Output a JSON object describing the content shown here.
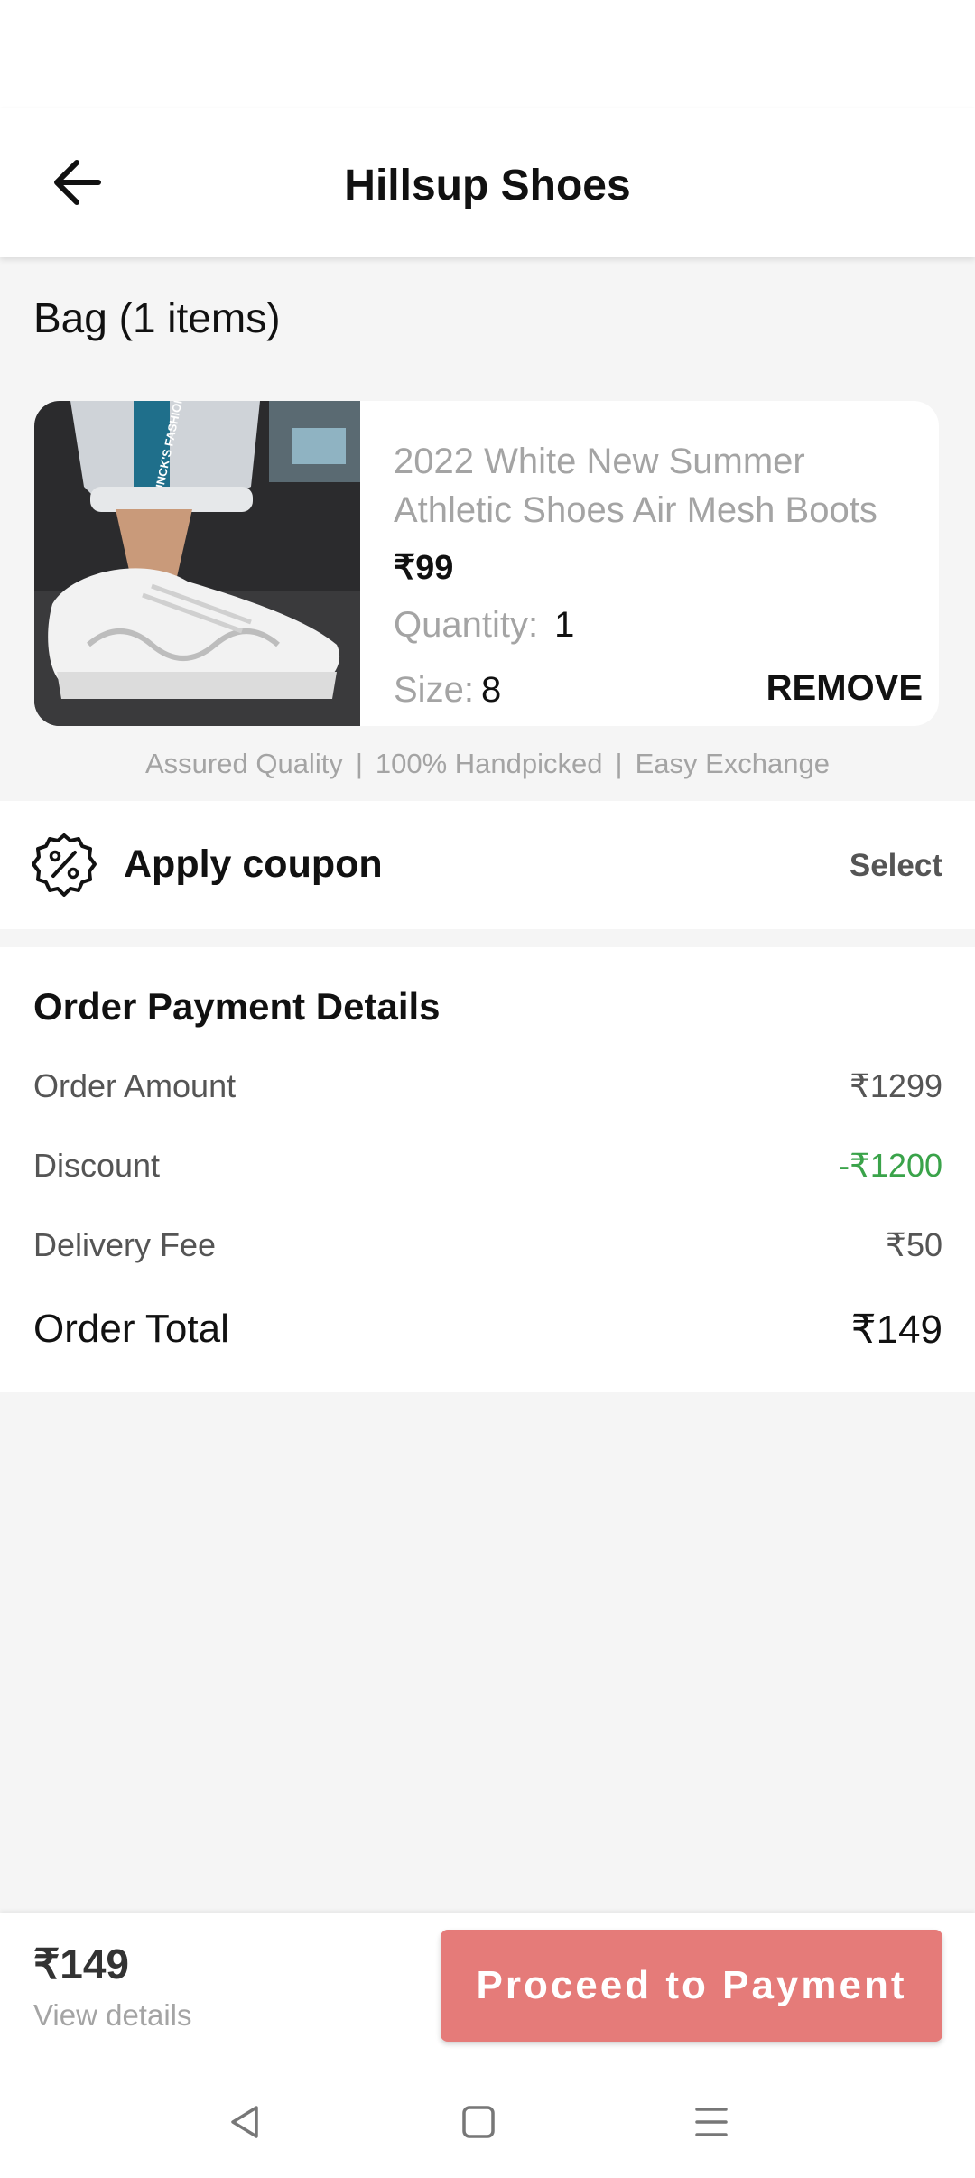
{
  "header": {
    "title": "Hillsup Shoes"
  },
  "bag": {
    "title": "Bag (1 items)",
    "item": {
      "name": "2022 White New Summer Athletic Shoes Air Mesh Boots",
      "price": "₹99",
      "quantity_label": "Quantity:",
      "quantity": "1",
      "size_label": "Size:",
      "size": "8",
      "remove_label": "REMOVE",
      "image_text": "RUNCK'S FASHION"
    }
  },
  "assurance": [
    "Assured Quality",
    "100% Handpicked",
    "Easy Exchange"
  ],
  "assurance_separator": "|",
  "coupon": {
    "label": "Apply coupon",
    "action": "Select"
  },
  "payment": {
    "title": "Order Payment Details",
    "rows": [
      {
        "label": "Order Amount",
        "value": "₹1299"
      },
      {
        "label": "Discount",
        "value": "-₹1200"
      },
      {
        "label": "Delivery Fee",
        "value": "₹50"
      }
    ],
    "total_label": "Order Total",
    "total_value": "₹149"
  },
  "footer": {
    "total": "₹149",
    "view_details": "View details",
    "proceed_label": "Proceed to Payment"
  },
  "colors": {
    "accent_button": "#e57b79",
    "discount_green": "#3aa34a",
    "muted_text": "#a4a4a4",
    "background": "#f5f5f5"
  },
  "icons": {
    "back": "arrow-left-icon",
    "coupon": "discount-badge-icon",
    "nav_back": "triangle-back-icon",
    "nav_home": "square-home-icon",
    "nav_menu": "menu-lines-icon"
  }
}
